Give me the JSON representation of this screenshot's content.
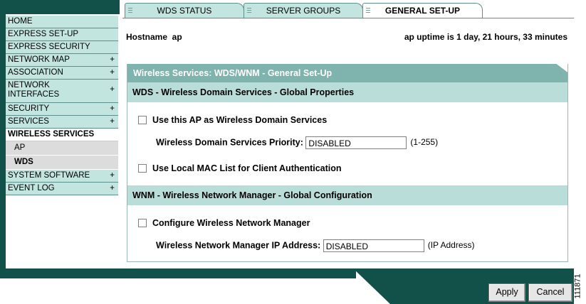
{
  "sidebar": {
    "items": [
      {
        "label": "HOME",
        "plus": ""
      },
      {
        "label": "EXPRESS SET-UP",
        "plus": ""
      },
      {
        "label": "EXPRESS SECURITY",
        "plus": ""
      },
      {
        "label": "NETWORK MAP",
        "plus": "+"
      },
      {
        "label": "ASSOCIATION",
        "plus": "+"
      },
      {
        "label": "NETWORK INTERFACES",
        "line1": "NETWORK",
        "line2": "INTERFACES",
        "plus": "+"
      },
      {
        "label": "SECURITY",
        "plus": "+"
      },
      {
        "label": "SERVICES",
        "plus": "+"
      },
      {
        "label": "WIRELESS SERVICES",
        "plus": ""
      },
      {
        "label": "SYSTEM SOFTWARE",
        "plus": "+"
      },
      {
        "label": "EVENT LOG",
        "plus": "+"
      }
    ],
    "sub_items": [
      {
        "label": "AP"
      },
      {
        "label": "WDS"
      }
    ]
  },
  "tabs": [
    {
      "label": "WDS STATUS"
    },
    {
      "label": "SERVER GROUPS"
    },
    {
      "label": "GENERAL SET-UP"
    }
  ],
  "header": {
    "hostname": "Hostname  ap",
    "uptime": "ap uptime is 1 day, 21 hours, 33 minutes"
  },
  "panel": {
    "title": "Wireless Services: WDS/WNM - General Set-Up",
    "wds_section": "WDS - Wireless Domain Services - Global Properties",
    "use_ap_wds": "Use this AP as Wireless Domain Services",
    "priority_label": "Wireless Domain Services Priority:",
    "priority_value": "DISABLED",
    "priority_hint": "(1-255)",
    "use_local_mac": "Use Local MAC List for Client Authentication",
    "wnm_section": "WNM - Wireless Network Manager - Global Configuration",
    "configure_wnm": "Configure Wireless Network Manager",
    "wnm_ip_label": "Wireless Network Manager IP Address:",
    "wnm_ip_value": "DISABLED",
    "wnm_ip_hint": "(IP Address)"
  },
  "buttons": {
    "apply": "Apply",
    "cancel": "Cancel"
  },
  "figure_id": "111871",
  "colors": {
    "frame": "#12504a",
    "nav": "#c3e5e0",
    "panel_title": "#7fb3ad",
    "section": "#b9ded9"
  }
}
